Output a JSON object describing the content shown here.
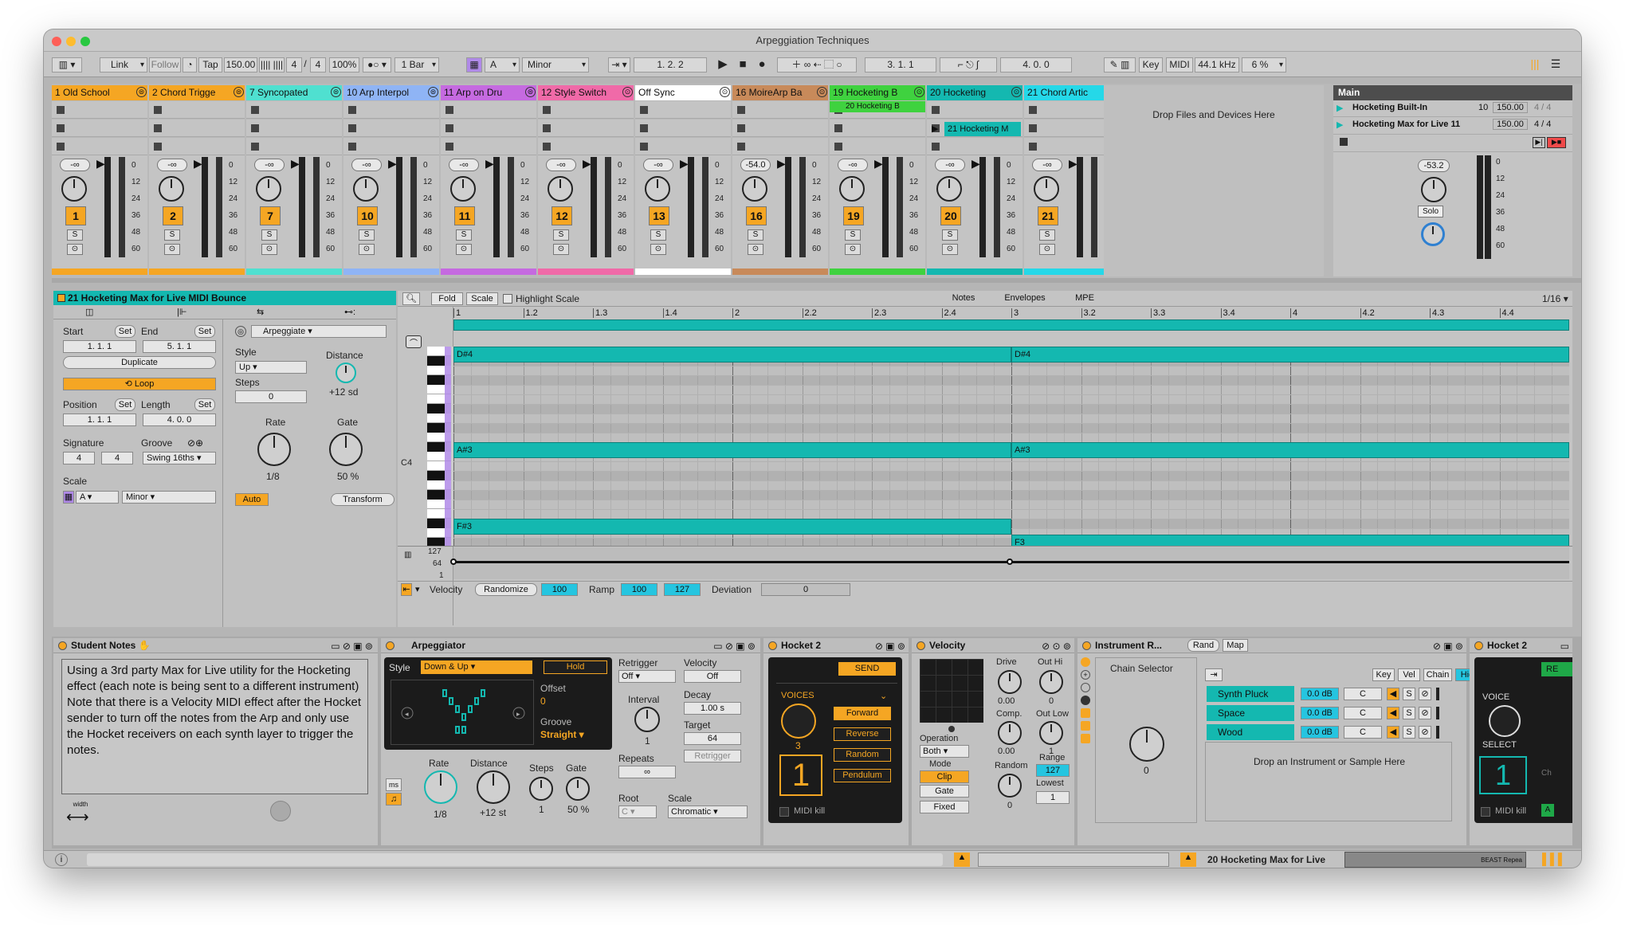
{
  "window": {
    "title": "Arpeggiation Techniques"
  },
  "control_bar": {
    "link": "Link",
    "follow": "Follow",
    "tap": "Tap",
    "tempo": "150.00",
    "signature_num": "4",
    "signature_den": "4",
    "zoom": "100%",
    "quantize": "1 Bar",
    "key_label": "A",
    "scale_label": "Minor",
    "position": "1.   2.   2",
    "loop_start": "3.   1.   1",
    "loop_length": "4.   0.   0",
    "key_btn": "Key",
    "midi_btn": "MIDI",
    "sample_rate": "44.1 kHz",
    "cpu": "6 %"
  },
  "tracks": [
    {
      "name": "1 Old School",
      "num": "1",
      "vol": "-∞",
      "color": "#f5a623"
    },
    {
      "name": "2 Chord Trigge",
      "num": "2",
      "vol": "-∞",
      "color": "#f5a623"
    },
    {
      "name": "7 Syncopated",
      "num": "7",
      "vol": "-∞",
      "color": "#4fe0d0"
    },
    {
      "name": "10 Arp Interpol",
      "num": "10",
      "vol": "-∞",
      "color": "#8fb4f5"
    },
    {
      "name": "11 Arp on Dru",
      "num": "11",
      "vol": "-∞",
      "color": "#c56ae0"
    },
    {
      "name": "12 Style Switch",
      "num": "12",
      "vol": "-∞",
      "color": "#f06aa8"
    },
    {
      "name": "Off Sync",
      "num": "13",
      "vol": "-∞",
      "color": "#ffffff"
    },
    {
      "name": "16 MoireArp Ba",
      "num": "16",
      "vol": "-54.0",
      "color": "#c88a5a"
    },
    {
      "name": "19 Hocketing B",
      "num": "19",
      "vol": "-∞",
      "color": "#3fd23f"
    },
    {
      "name": "20 Hocketing",
      "num": "20",
      "vol": "-∞",
      "color": "#14b8b0"
    },
    {
      "name": "21 Chord Artic",
      "num": "21",
      "vol": "-∞",
      "color": "#25d8e8"
    }
  ],
  "clips": {
    "c19": "20 Hocketing B",
    "c20": "21 Hocketing M"
  },
  "drop_files": "Drop Files and Devices Here",
  "main": {
    "title": "Main",
    "vol": "-53.2",
    "solo": "Solo",
    "rows": [
      {
        "name": "Hocketing Built-In",
        "a": "10",
        "b": "150.00",
        "c": "4 / 4"
      },
      {
        "name": "Hocketing Max for Live 11",
        "a": "",
        "b": "150.00",
        "c": "4 / 4"
      }
    ]
  },
  "meter_scale": [
    "0",
    "12",
    "24",
    "36",
    "48",
    "60"
  ],
  "clip": {
    "title": "21 Hocketing Max for Live MIDI Bounce",
    "start": "Start",
    "end": "End",
    "set": "Set",
    "start_val": "1.   1.   1",
    "end_val": "5.   1.   1",
    "duplicate": "Duplicate",
    "loop": "Loop",
    "position": "Position",
    "length": "Length",
    "pos_val": "1.   1.   1",
    "len_val": "4.   0.   0",
    "signature": "Signature",
    "groove": "Groove",
    "sig_num": "4",
    "sig_den": "4",
    "groove_val": "Swing 16ths",
    "scale": "Scale",
    "scale_key": "A",
    "scale_name": "Minor"
  },
  "arp_panel": {
    "mode": "Arpeggiate",
    "style": "Style",
    "style_val": "Up",
    "distance": "Distance",
    "distance_val": "+12 sd",
    "steps": "Steps",
    "steps_val": "0",
    "rate": "Rate",
    "rate_val": "1/8",
    "gate": "Gate",
    "gate_val": "50 %",
    "auto": "Auto",
    "transform": "Transform"
  },
  "editor": {
    "fold": "Fold",
    "scale": "Scale",
    "highlight": "Highlight Scale",
    "tabs": [
      "Notes",
      "Envelopes",
      "MPE"
    ],
    "grid": "1/16",
    "ruler": [
      "1",
      "1.2",
      "1.3",
      "1.4",
      "2",
      "2.2",
      "2.3",
      "2.4",
      "3",
      "3.2",
      "3.3",
      "3.4",
      "4",
      "4.2",
      "4.3",
      "4.4"
    ],
    "c4": "C4",
    "vel_scale": [
      "127",
      "64",
      "1"
    ],
    "velocity": "Velocity",
    "randomize": "Randomize",
    "vel_val": "100",
    "ramp": "Ramp",
    "ramp_a": "100",
    "ramp_b": "127",
    "deviation": "Deviation",
    "dev_val": "0"
  },
  "notes": [
    {
      "label": "D#4",
      "start": 1,
      "end": 3,
      "row": "d"
    },
    {
      "label": "D#4",
      "start": 3,
      "end": 5,
      "row": "d"
    },
    {
      "label": "A#3",
      "start": 1,
      "end": 3,
      "row": "a"
    },
    {
      "label": "A#3",
      "start": 3,
      "end": 5,
      "row": "a"
    },
    {
      "label": "F#3",
      "start": 1,
      "end": 3,
      "row": "f"
    },
    {
      "label": "F3",
      "start": 3,
      "end": 5,
      "row": "e"
    }
  ],
  "devices": {
    "student": {
      "title": "Student Notes",
      "text": "Using a 3rd party Max for Live utility for the Hocketing effect (each note is being sent to a different instrument)\nNote that there is a Velocity MIDI effect after the Hocket sender to turn off the notes from the Arp and only use the Hocket receivers on each synth layer to trigger the notes.",
      "width": "width"
    },
    "arpeggiator": {
      "title": "Arpeggiator",
      "style": "Style",
      "style_val": "Down & Up",
      "hold": "Hold",
      "offset": "Offset",
      "offset_val": "0",
      "groove": "Groove",
      "groove_val": "Straight",
      "ms": "ms",
      "rate": "Rate",
      "rate_val": "1/8",
      "distance": "Distance",
      "distance_val": "+12 st",
      "steps": "Steps",
      "steps_val": "1",
      "gate": "Gate",
      "gate_val": "50 %",
      "retrigger": "Retrigger",
      "retrig_val": "Off",
      "interval": "Interval",
      "interval_val": "1",
      "repeats": "Repeats",
      "repeats_val": "∞",
      "velocity": "Velocity",
      "vel_val": "Off",
      "decay": "Decay",
      "decay_val": "1.00 s",
      "target": "Target",
      "target_val": "64",
      "retrig_btn": "Retrigger",
      "root": "Root",
      "root_val": "C",
      "scale": "Scale",
      "scale_val": "Chromatic"
    },
    "hocket": {
      "title": "Hocket 2",
      "send": "SEND",
      "voices": "VOICES",
      "voices_val": "3",
      "big": "1",
      "forward": "Forward",
      "reverse": "Reverse",
      "random": "Random",
      "pendulum": "Pendulum",
      "midikill": "MIDI kill"
    },
    "velocity": {
      "title": "Velocity",
      "drive": "Drive",
      "drive_val": "0.00",
      "outhi": "Out Hi",
      "outhi_val": "0",
      "comp": "Comp.",
      "comp_val": "0.00",
      "outlow": "Out Low",
      "outlow_val": "1",
      "operation": "Operation",
      "op_val": "Both",
      "mode": "Mode",
      "clip": "Clip",
      "gate": "Gate",
      "fixed": "Fixed",
      "random": "Random",
      "random_val": "0",
      "range": "Range",
      "range_val": "127",
      "lowest": "Lowest",
      "lowest_val": "1"
    },
    "rack": {
      "title": "Instrument R...",
      "rand": "Rand",
      "map": "Map",
      "chain_selector": "Chain Selector",
      "knob_val": "0",
      "key": "Key",
      "vel": "Vel",
      "chain": "Chain",
      "hide": "Hide",
      "chains": [
        {
          "name": "Synth Pluck",
          "vol": "0.0 dB",
          "pan": "C"
        },
        {
          "name": "Space",
          "vol": "0.0 dB",
          "pan": "C"
        },
        {
          "name": "Wood",
          "vol": "0.0 dB",
          "pan": "C"
        }
      ],
      "drop": "Drop an Instrument or Sample Here",
      "s": "S"
    },
    "hocket2": {
      "title": "Hocket 2",
      "re": "RE",
      "voice": "VOICE",
      "select": "SELECT",
      "big": "1",
      "midikill": "MIDI kill",
      "a": "A",
      "ch": "Ch"
    }
  },
  "status": {
    "track": "20 Hocketing Max for Live",
    "mini": "BEAST Repea"
  }
}
